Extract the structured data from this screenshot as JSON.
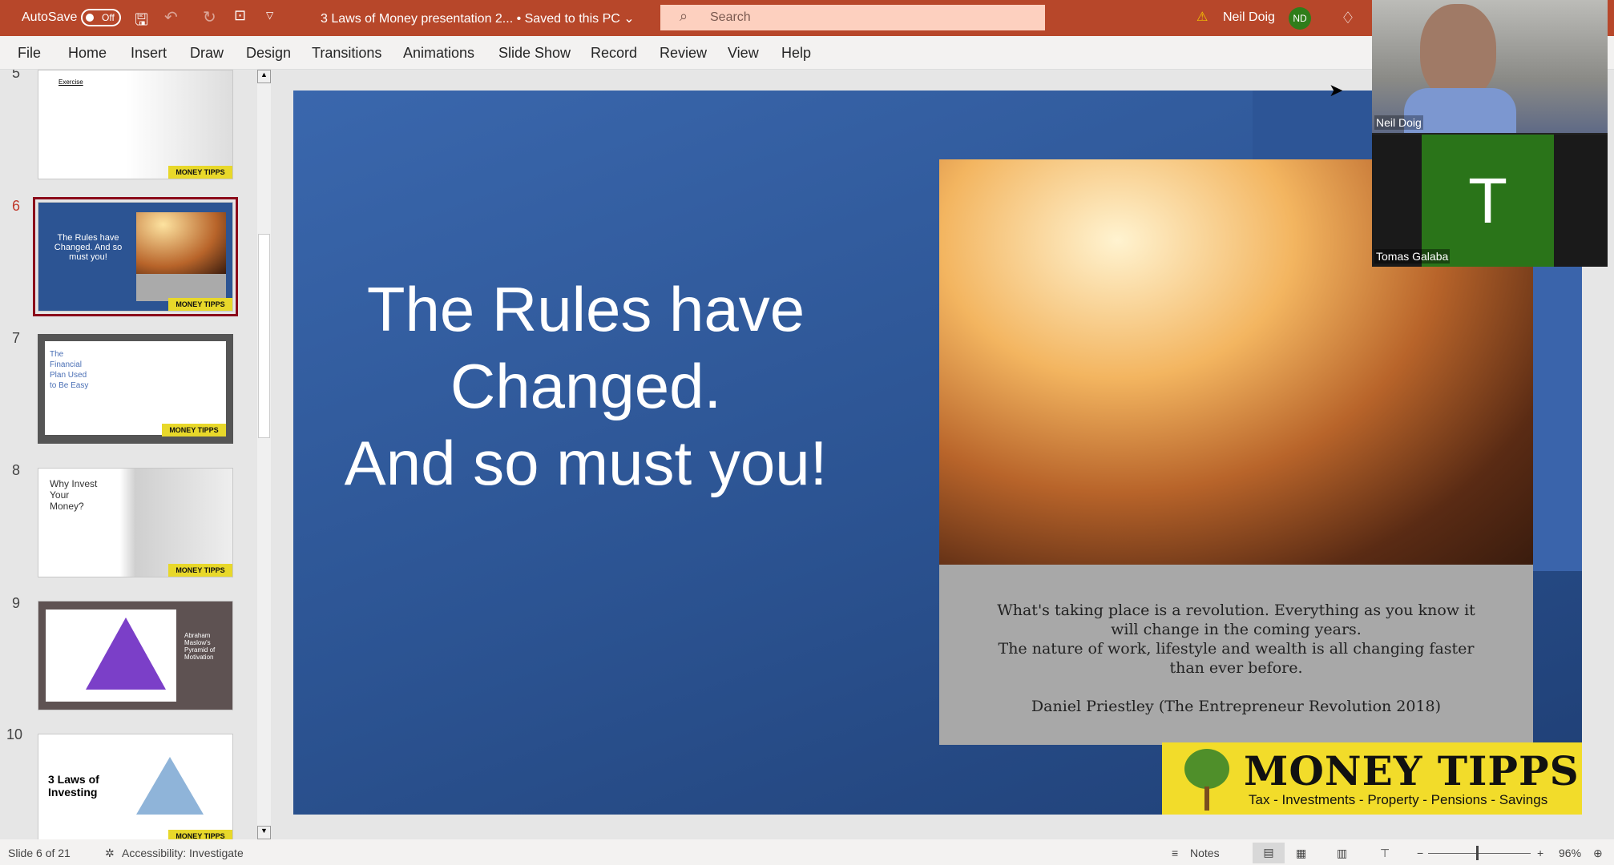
{
  "titlebar": {
    "autosave_label": "AutoSave",
    "autosave_state": "Off",
    "doc_title": "3 Laws of Money presentation 2... • Saved to this PC ⌄",
    "search_placeholder": "Search",
    "user_name": "Neil Doig",
    "user_initials": "ND"
  },
  "menu": [
    "File",
    "Home",
    "Insert",
    "Draw",
    "Design",
    "Transitions",
    "Animations",
    "Slide Show",
    "Record",
    "Review",
    "View",
    "Help"
  ],
  "thumbnails": [
    {
      "num": "5",
      "title": "Exercise",
      "logo": "MONEY TIPPS"
    },
    {
      "num": "6",
      "title": "The Rules have Changed. And so must you!",
      "logo": "MONEY TIPPS"
    },
    {
      "num": "7",
      "title": "The Financial Plan Used to Be Easy",
      "logo": "MONEY TIPPS"
    },
    {
      "num": "8",
      "title": "Why Invest Your Money?",
      "logo": "MONEY TIPPS"
    },
    {
      "num": "9",
      "title": "Abraham Maslow's Pyramid of Motivation"
    },
    {
      "num": "10",
      "title": "3 Laws of Investing",
      "logo": "MONEY TIPPS"
    }
  ],
  "slide": {
    "title_lines": [
      "The Rules have",
      "Changed.",
      "And so must you!"
    ],
    "quote_lines": [
      "What's taking place is a revolution. Everything as you know it",
      "will change in the coming years.",
      "The nature of work, lifestyle and wealth is all changing faster",
      "than ever before."
    ],
    "attribution": "Daniel Priestley (The Entrepreneur Revolution 2018)",
    "logo_title": "MONEY TIPPS",
    "logo_tagline": "Tax - Investments - Property - Pensions - Savings"
  },
  "video": {
    "participant1": "Neil Doig",
    "participant2": "Tomas Galaba",
    "participant2_initial": "T"
  },
  "status": {
    "slide_info": "Slide 6 of 21",
    "accessibility": "Accessibility: Investigate",
    "notes": "Notes",
    "zoom": "96%"
  },
  "colors": {
    "brand": "#b7472a",
    "selected_thumb": "#8b0a1a",
    "logo_yellow": "#f2dc2a"
  }
}
